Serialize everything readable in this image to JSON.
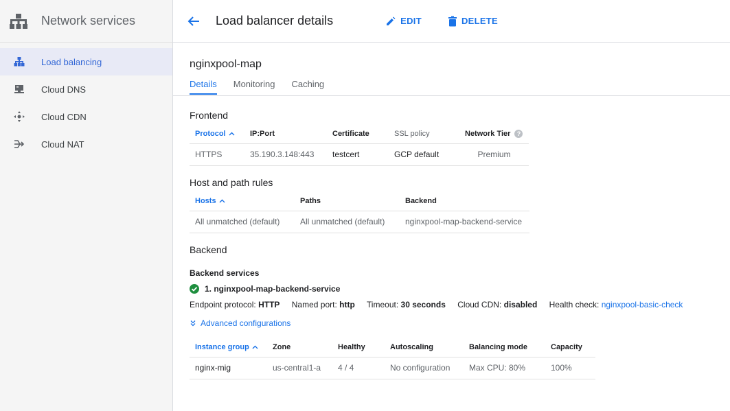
{
  "sidebar": {
    "title": "Network services",
    "items": [
      {
        "label": "Load balancing",
        "icon": "load-balancing-icon",
        "active": true
      },
      {
        "label": "Cloud DNS",
        "icon": "dns-icon",
        "active": false
      },
      {
        "label": "Cloud CDN",
        "icon": "cdn-icon",
        "active": false
      },
      {
        "label": "Cloud NAT",
        "icon": "nat-icon",
        "active": false
      }
    ]
  },
  "header": {
    "title": "Load balancer details",
    "edit_label": "EDIT",
    "delete_label": "DELETE"
  },
  "lb": {
    "name": "nginxpool-map",
    "tabs": [
      "Details",
      "Monitoring",
      "Caching"
    ]
  },
  "frontend": {
    "title": "Frontend",
    "columns": [
      "Protocol",
      "IP:Port",
      "Certificate",
      "SSL policy",
      "Network Tier"
    ],
    "row": [
      "HTTPS",
      "35.190.3.148:443",
      "testcert",
      "GCP default",
      "Premium"
    ]
  },
  "host_rules": {
    "title": "Host and path rules",
    "columns": [
      "Hosts",
      "Paths",
      "Backend"
    ],
    "row": [
      "All unmatched (default)",
      "All unmatched (default)",
      "nginxpool-map-backend-service"
    ]
  },
  "backend": {
    "title": "Backend",
    "services_title": "Backend services",
    "service_name": "1. nginxpool-map-backend-service",
    "endpoint_label": "Endpoint protocol:",
    "endpoint_value": "HTTP",
    "port_label": "Named port:",
    "port_value": "http",
    "timeout_label": "Timeout:",
    "timeout_value": "30 seconds",
    "cdn_label": "Cloud CDN:",
    "cdn_value": "disabled",
    "health_label": "Health check:",
    "health_value": "nginxpool-basic-check",
    "advanced_label": "Advanced configurations"
  },
  "instance_groups": {
    "columns": [
      "Instance group",
      "Zone",
      "Healthy",
      "Autoscaling",
      "Balancing mode",
      "Capacity"
    ],
    "row": [
      "nginx-mig",
      "us-central1-a",
      "4 / 4",
      "No configuration",
      "Max CPU: 80%",
      "100%"
    ]
  },
  "colors": {
    "accent": "#1a73e8",
    "success": "#1e8e3e",
    "active_bg": "#e8eaf6"
  }
}
